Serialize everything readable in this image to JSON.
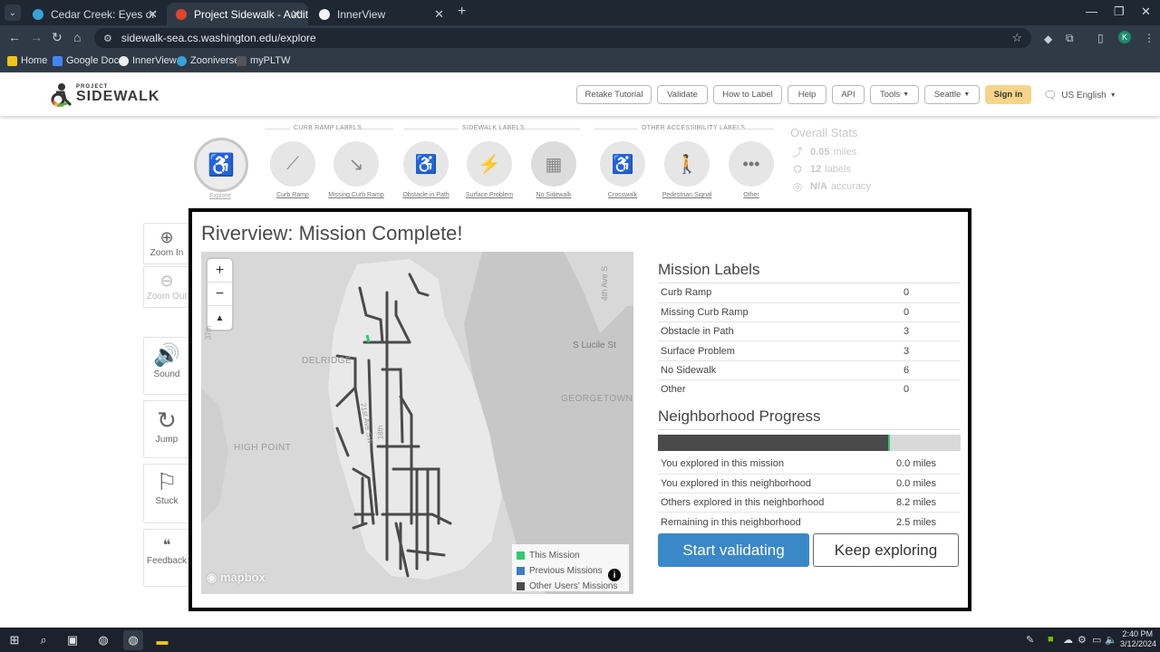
{
  "browser": {
    "tabs": [
      {
        "title": "Cedar Creek: Eyes on the Wild -"
      },
      {
        "title": "Project Sidewalk - Audit"
      },
      {
        "title": "InnerView"
      }
    ],
    "url": "sidewalk-sea.cs.washington.edu/explore",
    "profile_initial": "K",
    "bookmarks": [
      "Home",
      "Google Docs",
      "InnerView",
      "Zooniverse",
      "myPLTW"
    ]
  },
  "header": {
    "logo_small": "PROJECT",
    "logo_big": "SIDEWALK",
    "buttons": [
      "Retake Tutorial",
      "Validate",
      "How to Label",
      "Help",
      "API",
      "Tools",
      "Seattle"
    ],
    "signin": "Sign in",
    "language": "US English"
  },
  "toolbar": {
    "sections": [
      "CURB RAMP LABELS",
      "SIDEWALK LABELS",
      "OTHER ACCESSIBILITY LABELS"
    ],
    "explore_label": "Explore",
    "tools": [
      "Curb Ramp",
      "Missing Curb Ramp",
      "Obstacle in Path",
      "Surface Problem",
      "No Sidewalk",
      "Crosswalk",
      "Pedestrian Signal",
      "Other"
    ]
  },
  "overall_stats": {
    "title": "Overall Stats",
    "miles_value": "0.05",
    "miles_unit": "miles",
    "labels_value": "12",
    "labels_unit": "labels",
    "accuracy_value": "N/A",
    "accuracy_unit": "accuracy"
  },
  "side_controls": [
    "Zoom In",
    "Zoom Out",
    "Sound",
    "Jump",
    "Stuck",
    "Feedback"
  ],
  "modal": {
    "title": "Riverview: Mission Complete!",
    "map": {
      "place_labels": [
        "DELRIDGE",
        "HIGH POINT",
        "GEORGETOWN",
        "S Lucile St",
        "4th Ave S",
        "21st Ave SW",
        "18th",
        "37th"
      ],
      "legend": [
        "This Mission",
        "Previous Missions",
        "Other Users' Missions"
      ],
      "legend_colors": [
        "#2ecc71",
        "#3a7fc0",
        "#4a4a4a"
      ],
      "attribution": "mapbox"
    },
    "mission_labels": {
      "title": "Mission Labels",
      "rows": [
        {
          "label": "Curb Ramp",
          "count": "0"
        },
        {
          "label": "Missing Curb Ramp",
          "count": "0"
        },
        {
          "label": "Obstacle in Path",
          "count": "3"
        },
        {
          "label": "Surface Problem",
          "count": "3"
        },
        {
          "label": "No Sidewalk",
          "count": "6"
        },
        {
          "label": "Other",
          "count": "0"
        }
      ]
    },
    "neighborhood_progress": {
      "title": "Neighborhood Progress",
      "progress_fraction": 0.76,
      "rows": [
        {
          "label": "You explored in this mission",
          "value": "0.0 miles"
        },
        {
          "label": "You explored in this neighborhood",
          "value": "0.0 miles"
        },
        {
          "label": "Others explored in this neighborhood",
          "value": "8.2 miles"
        },
        {
          "label": "Remaining in this neighborhood",
          "value": "2.5 miles"
        }
      ]
    },
    "start_validating": "Start validating",
    "keep_exploring": "Keep exploring"
  },
  "taskbar": {
    "time": "2:40 PM",
    "date": "3/12/2024"
  }
}
